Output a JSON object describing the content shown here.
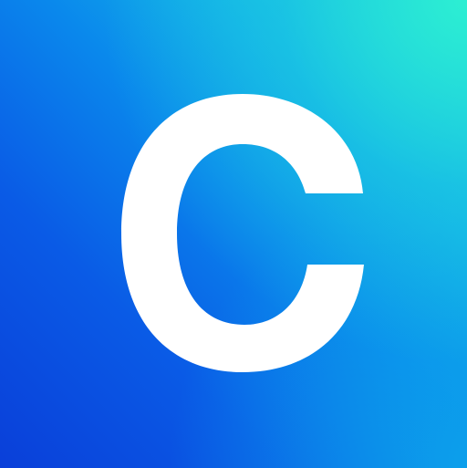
{
  "logo": {
    "letter": "C",
    "letter_color": "#ffffff"
  },
  "colors": {
    "gradient_bottom_left": "#0a3fd9",
    "gradient_middle": "#0a88ec",
    "gradient_top_right": "#2df0d2",
    "gradient_bottom_right": "#0ca5eb"
  }
}
